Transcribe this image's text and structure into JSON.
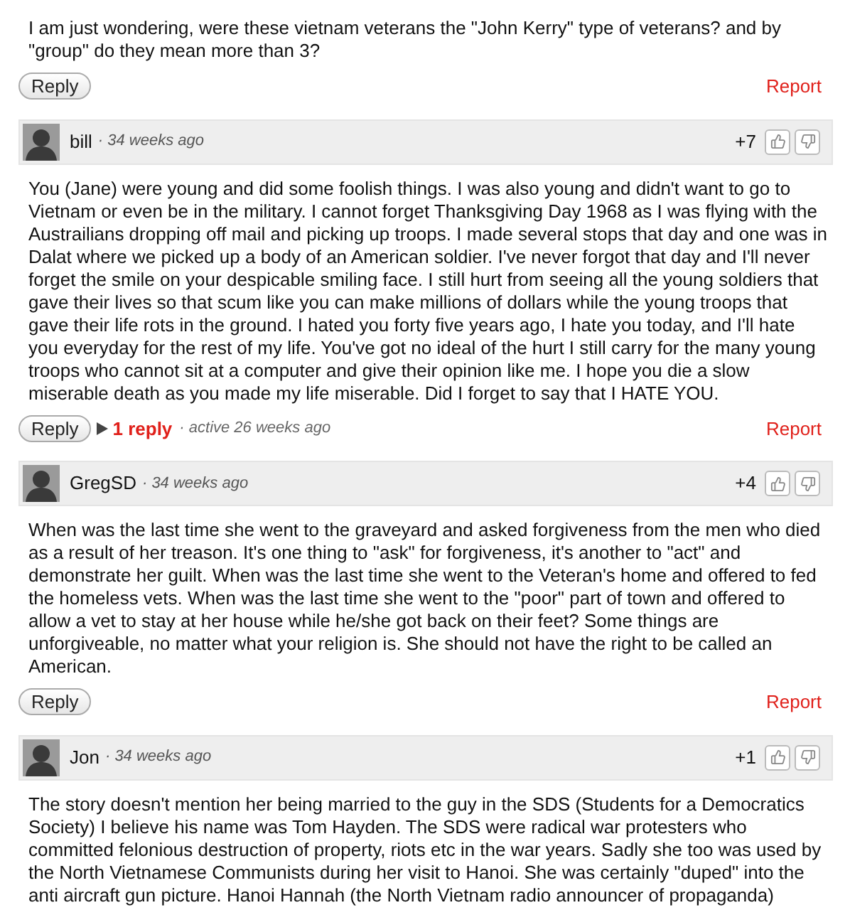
{
  "top_comment_tail": {
    "text": "I am just wondering, were these vietnam veterans the \"John Kerry\" type of veterans? and by \"group\" do they mean more than 3?",
    "reply_label": "Reply",
    "report_label": "Report"
  },
  "comments": [
    {
      "author": "bill",
      "time": "· 34 weeks ago",
      "score": "+7",
      "text": "You (Jane) were young and did some foolish things. I was also young and didn't want to go to Vietnam or even be in the military. I cannot forget Thanksgiving Day 1968 as I was flying with the Austrailians dropping off mail and picking up troops. I made several stops that day and one was in Dalat where we picked up a body of an American soldier. I've never forgot that day and I'll never forget the smile on your despicable smiling face. I still hurt from seeing all the young soldiers that gave their lives so that scum like you can make millions of dollars while the young troops that gave their life rots in the ground. I hated you forty five years ago, I hate you today, and I'll hate you everyday for the rest of my life. You've got no ideal of the hurt I still carry for the many young troops who cannot sit at a computer and give their opinion like me. I hope you die a slow miserable death as you made my life miserable. Did I forget to say that I HATE YOU.",
      "reply_label": "Reply",
      "replies": {
        "label": "1 reply",
        "activity": "· active 26 weeks ago"
      },
      "report_label": "Report"
    },
    {
      "author": "GregSD",
      "time": "· 34 weeks ago",
      "score": "+4",
      "text": "When was the last time she went to the graveyard and asked forgiveness from the men who died as a result of her treason. It's one thing to \"ask\" for forgiveness, it's another to \"act\" and demonstrate her guilt. When was the last time she went to the Veteran's home and offered to fed the homeless vets. When was the last time she went to the \"poor\" part of town and offered to allow a vet to stay at her house while he/she got back on their feet? Some things are unforgiveable, no matter what your religion is. She should not have the right to be called an American.",
      "reply_label": "Reply",
      "report_label": "Report"
    },
    {
      "author": "Jon",
      "time": "· 34 weeks ago",
      "score": "+1",
      "text": "The story doesn't mention her being married to the guy in the SDS (Students for a Democratics Society) I believe his name was Tom Hayden. The SDS were radical war protesters who committed felonious destruction of property, riots etc in the war years. Sadly she too was used by the North Vietnamese Communists during her visit to Hanoi. She was certainly \"duped\" into the anti aircraft gun picture. Hanoi Hannah (the North Vietnam radio announcer of propaganda)"
    }
  ]
}
